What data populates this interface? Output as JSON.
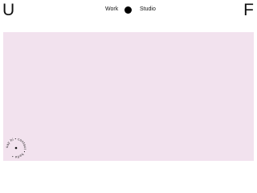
{
  "header": {
    "logo_left": "U",
    "logo_right": "F",
    "nav": {
      "work_label": "Work",
      "studio_label": "Studio",
      "separator_icon": "filled-circle"
    }
  },
  "hero": {
    "background_color": "#f2e2ee"
  },
  "badge": {
    "circular_text": "say hi • contact • hello • "
  },
  "colors": {
    "text": "#111111",
    "dot": "#000000",
    "background": "#ffffff"
  }
}
